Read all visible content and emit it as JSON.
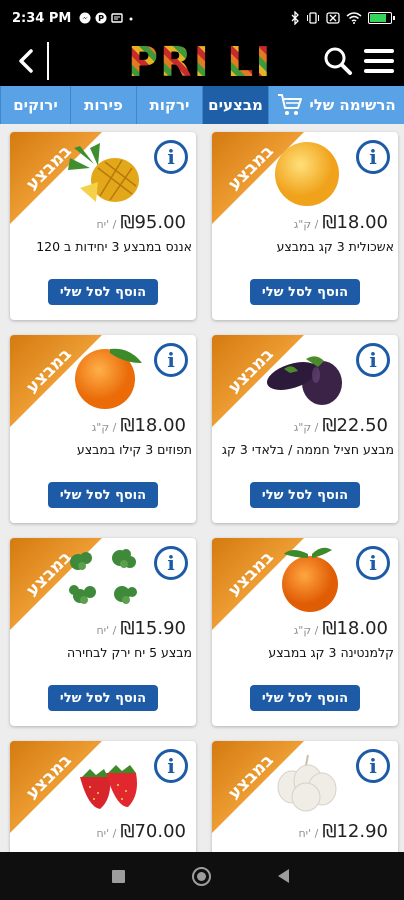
{
  "status_bar": {
    "time": "2:34 PM",
    "left_icons": [
      "facebook-messenger-icon",
      "pinterest-icon",
      "message-icon",
      "dot-icon"
    ],
    "right_icons": [
      "bluetooth-icon",
      "vibrate-icon",
      "no-sim-icon",
      "wifi-icon"
    ],
    "battery_level": 0.85,
    "battery_color": "#35d35a"
  },
  "header": {
    "logo_text": "PRI LI",
    "back_icon": "chevron-left-icon",
    "search_icon": "search-icon",
    "menu_icon": "hamburger-menu-icon"
  },
  "tabs": {
    "cart_label": "הרשימה שלי",
    "items": [
      {
        "label": "מבצעים",
        "active": true
      },
      {
        "label": "ירקות",
        "active": false
      },
      {
        "label": "פירות",
        "active": false
      },
      {
        "label": "ירוקים",
        "active": false
      }
    ],
    "active_color": "#1f5fa8",
    "bar_color": "#5aa2e6"
  },
  "ribbon_label": "במבצע",
  "add_button_label": "הוסף לסל שלי",
  "currency": "₪",
  "products": [
    {
      "name": "אשכולית 3 קג במבצע",
      "price": "18.00",
      "unit": "ק\"ג /",
      "image": "grapefruit"
    },
    {
      "name": "אננס במבצע 3 יחידות ב 120",
      "price": "95.00",
      "unit": "יח' /",
      "image": "pineapple"
    },
    {
      "name": "מבצע חציל חממה / בלאדי 3 קג",
      "price": "22.50",
      "unit": "ק\"ג /",
      "image": "eggplant"
    },
    {
      "name": "תפוזים 3 קילו במבצע",
      "price": "18.00",
      "unit": "ק\"ג /",
      "image": "orange"
    },
    {
      "name": "קלמנטינה 3 קג במבצע",
      "price": "18.00",
      "unit": "ק\"ג /",
      "image": "clementine"
    },
    {
      "name": "מבצע 5 יח ירק לבחירה",
      "price": "15.90",
      "unit": "יח' /",
      "image": "herbs"
    },
    {
      "name": "",
      "price": "12.90",
      "unit": "יח' /",
      "image": "garlic"
    },
    {
      "name": "",
      "price": "70.00",
      "unit": "יח' /",
      "image": "strawberries"
    }
  ],
  "nav_bar": {
    "recents_icon": "square-icon",
    "home_icon": "circle-home-icon",
    "back_icon": "triangle-back-icon"
  }
}
